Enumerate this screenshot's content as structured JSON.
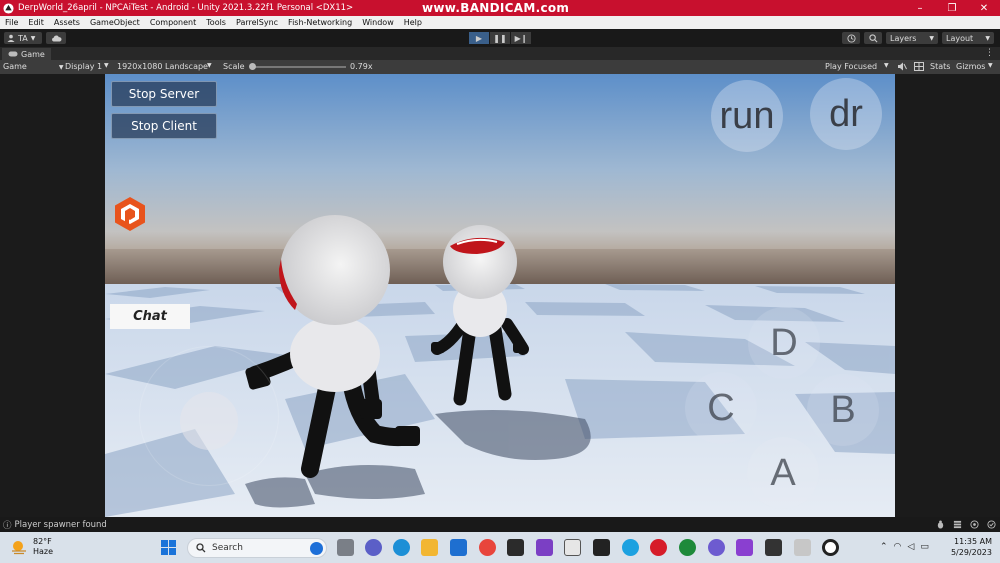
{
  "window": {
    "title": "DerpWorld_26april - NPCAiTest - Android - Unity 2021.3.22f1 Personal <DX11>",
    "watermark": "www.BANDICAM.com",
    "minimize": "–",
    "maximize": "❐",
    "close": "✕"
  },
  "menu": [
    "File",
    "Edit",
    "Assets",
    "GameObject",
    "Component",
    "Tools",
    "ParrelSync",
    "Fish-Networking",
    "Window",
    "Help"
  ],
  "toolbar": {
    "account": "TA",
    "layers": "Layers",
    "layout": "Layout"
  },
  "tab": {
    "label": "Game",
    "more": "⋮"
  },
  "game_toolbar": {
    "mode": "Game",
    "display": "Display 1",
    "resolution": "1920x1080 Landscape",
    "scale_label": "Scale",
    "scale_value": "0.79x",
    "scale_fraction": 0.02,
    "play_mode": "Play Focused",
    "stats": "Stats",
    "gizmos": "Gizmos"
  },
  "game_ui": {
    "stop_server": "Stop Server",
    "stop_client": "Stop Client",
    "chat": "Chat",
    "run": "run",
    "dr": "dr",
    "button_a": "A",
    "button_b": "B",
    "button_c": "C",
    "button_d": "D"
  },
  "status": {
    "message": "Player spawner found",
    "info_icon": "ⓘ"
  },
  "taskbar": {
    "temperature": "82°F",
    "weather": "Haze",
    "search_placeholder": "Search",
    "time": "11:35 AM",
    "date": "5/29/2023"
  },
  "colors": {
    "title_bar": "#c8102e",
    "play_active": "#3a5f8a",
    "sky_top": "#5d8fc9",
    "logo_orange": "#e8531c"
  }
}
